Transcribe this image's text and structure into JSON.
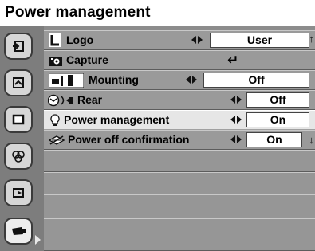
{
  "title": "Power management",
  "tabs": [
    {
      "icon": "input-icon"
    },
    {
      "icon": "screen-icon"
    },
    {
      "icon": "image-icon"
    },
    {
      "icon": "color-icon"
    },
    {
      "icon": "display-icon"
    },
    {
      "icon": "setting-icon"
    }
  ],
  "rows": [
    {
      "label": "Logo",
      "value": "User",
      "icon": "logo-icon"
    },
    {
      "label": "Capture",
      "value": "↵",
      "icon": "camera-icon"
    },
    {
      "label": "Mounting",
      "value": "Off",
      "icon": "mounting-icon"
    },
    {
      "label": "Rear",
      "value": "Off",
      "icon": "rear-icon"
    },
    {
      "label": "Power management",
      "value": "On",
      "icon": "bulb-icon"
    },
    {
      "label": "Power off confirmation",
      "value": "On",
      "icon": "power-off-icon"
    }
  ],
  "scroll_up": "↑",
  "scroll_down": "↓",
  "colors": {
    "panel": "#8c8c8c",
    "row": "#9a9a9a",
    "selected": "#e6e6e6"
  }
}
